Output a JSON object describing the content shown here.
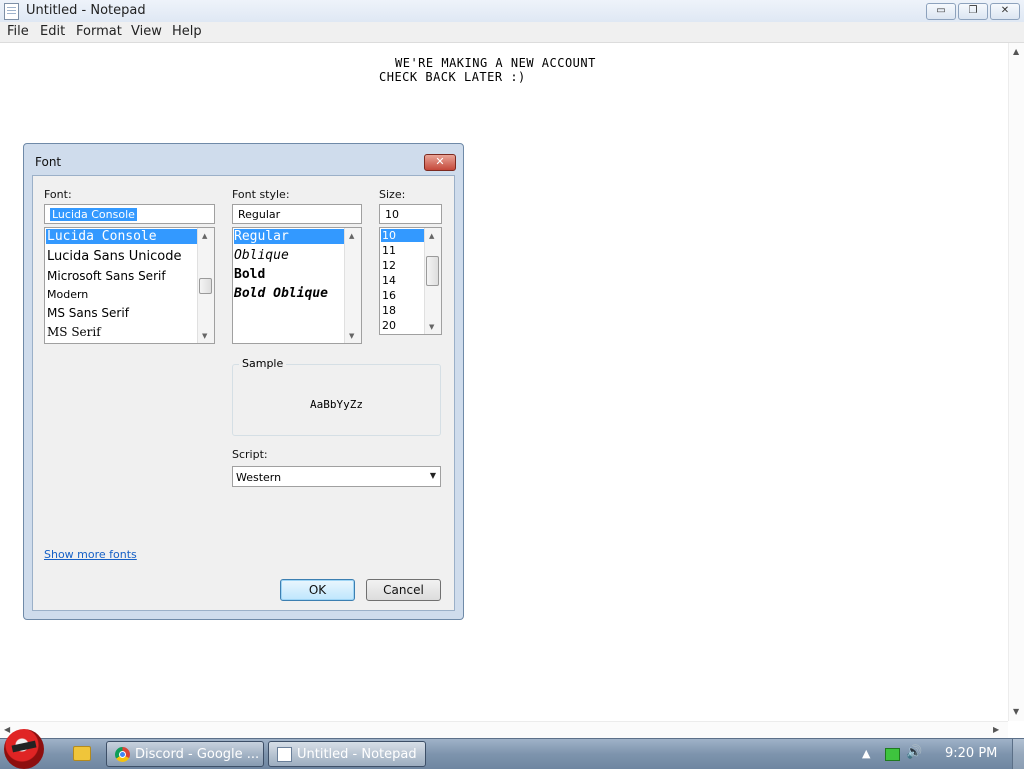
{
  "window": {
    "title": "Untitled - Notepad",
    "controls": {
      "minimize": "▭",
      "restore": "❐",
      "close": "✕"
    }
  },
  "menu": {
    "file": "File",
    "edit": "Edit",
    "format": "Format",
    "view": "View",
    "help": "Help"
  },
  "editor": {
    "lines": [
      "WE'RE MAKING A NEW ACCOUNT",
      "CHECK BACK LATER :)"
    ]
  },
  "dialog": {
    "title": "Font",
    "close": "✕",
    "font_label": "Font:",
    "font_value": "Lucida Console",
    "font_list": [
      "Lucida Console",
      "Lucida Sans Unicode",
      "Microsoft Sans Serif",
      "Modern",
      "MS Sans Serif",
      "MS Serif"
    ],
    "style_label": "Font style:",
    "style_value": "Regular",
    "style_list": [
      "Regular",
      "Oblique",
      "Bold",
      "Bold Oblique"
    ],
    "size_label": "Size:",
    "size_value": "10",
    "size_list": [
      "10",
      "11",
      "12",
      "14",
      "16",
      "18",
      "20"
    ],
    "sample_label": "Sample",
    "sample_text": "AaBbYyZz",
    "script_label": "Script:",
    "script_value": "Western",
    "more_fonts": "Show more fonts",
    "ok": "OK",
    "cancel": "Cancel"
  },
  "taskbar": {
    "tasks": [
      {
        "label": "Discord - Google ...",
        "icon": "chrome-icon"
      },
      {
        "label": "Untitled - Notepad",
        "icon": "notepad-icon"
      }
    ],
    "tray_expand": "▲",
    "volume": "🔊",
    "clock": "9:20 PM"
  }
}
